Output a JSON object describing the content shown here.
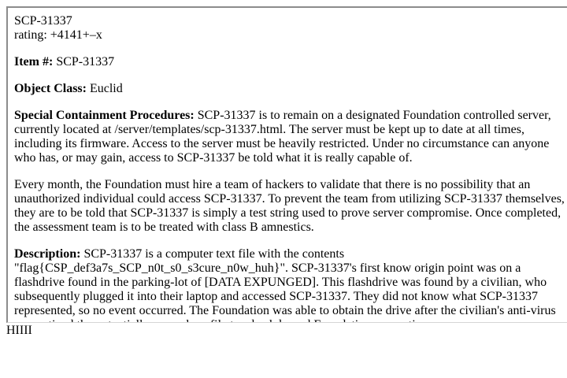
{
  "header": {
    "title": "SCP-31337",
    "rating": "rating: +4141+–x"
  },
  "item": {
    "label": "Item #:",
    "value": " SCP-31337"
  },
  "object_class": {
    "label": "Object Class:",
    "value": " Euclid"
  },
  "procedures": {
    "label": "Special Containment Procedures:",
    "text": " SCP-31337 is to remain on a designated Foundation controlled server, currently located at /server/templates/scp-31337.html. The server must be kept up to date at all times, including its firmware. Access to the server must be heavily restricted. Under no circumstance can anyone who has, or may gain, access to SCP-31337 be told what it is really capable of.",
    "paragraph2": "Every month, the Foundation must hire a team of hackers to validate that there is no possibility that an unauthorized individual could access SCP-31337. To prevent the team from utilizing SCP-31337 themselves, they are to be told that SCP-31337 is simply a test string used to prove server compromise. Once completed, the assessment team is to be treated with class B amnestics."
  },
  "description": {
    "label": "Description:",
    "text": " SCP-31337 is a computer text file with the contents \"flag{CSP_def3a7s_SCP_n0t_s0_s3cure_n0w_huh}\". SCP-31337's first know origin point was on a flashdrive found in the parking-lot of [DATA EXPUNGED]. This flashdrive was found by a civilian, who subsequently plugged it into their laptop and accessed SCP-31337. They did not know what SCP-31337 represented, so no event occurred. The Foundation was able to obtain the drive after the civilian's anti-virus quarantined the potentially anomalous file to a backdoored Foundation quarantine server."
  },
  "footer_text": "HIIII"
}
